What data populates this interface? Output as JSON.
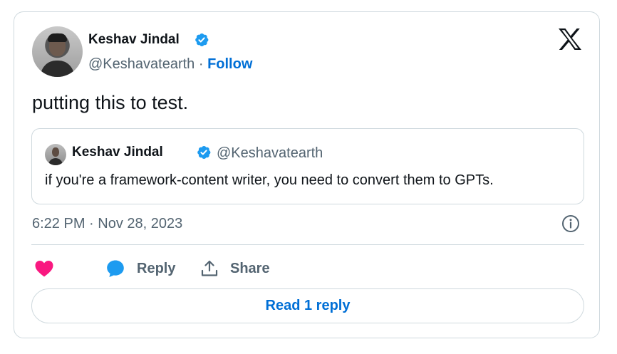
{
  "author": {
    "name": "Keshav Jindal",
    "handle": "@Keshavatearth",
    "separator": " · ",
    "follow_label": "Follow"
  },
  "tweet": {
    "text": "putting this to test.",
    "timestamp": "6:22 PM · Nov 28, 2023"
  },
  "quoted_tweet": {
    "name": "Keshav Jindal",
    "handle": "@Keshavatearth",
    "text": "if you're a framework-content writer, you need to convert them to GPTs."
  },
  "actions": {
    "reply_label": "Reply",
    "share_label": "Share"
  },
  "read_replies_label": "Read 1 reply",
  "colors": {
    "link": "#006fd6",
    "verified": "#1d9bf0",
    "like": "#f91880",
    "reply_icon": "#1d9bf0",
    "muted": "#536471",
    "border": "#cfd9de"
  },
  "icons": [
    "verified-badge-icon",
    "x-logo-icon",
    "info-icon",
    "heart-icon",
    "reply-bubble-icon",
    "share-icon"
  ]
}
